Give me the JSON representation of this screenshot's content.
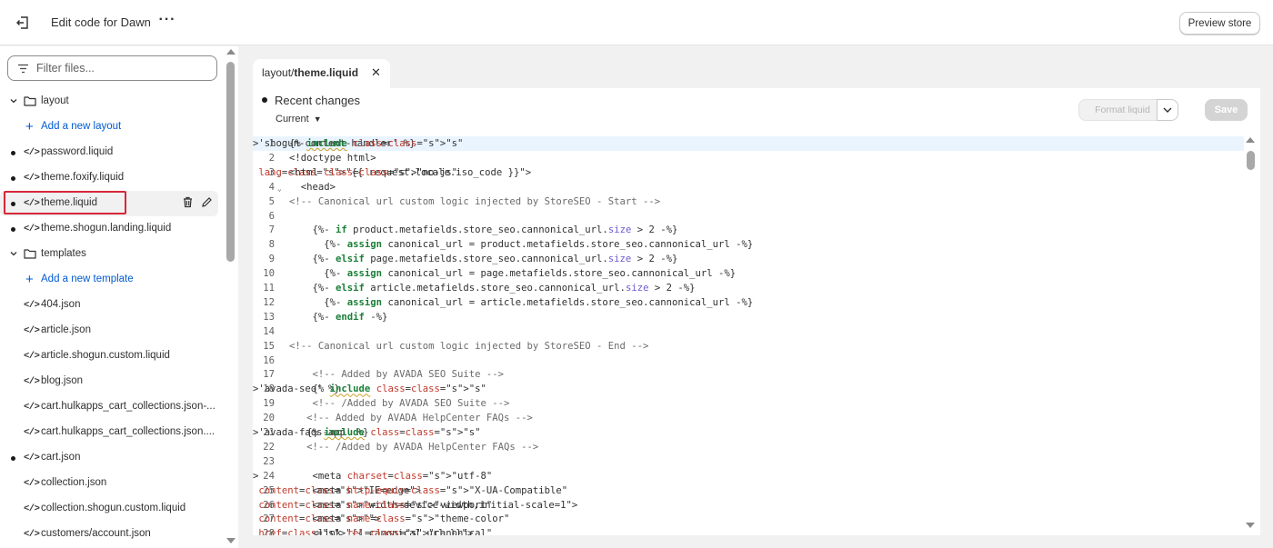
{
  "topbar": {
    "title": "Edit code for Dawn",
    "more_label": "···",
    "preview_label": "Preview store"
  },
  "sidebar": {
    "filter_placeholder": "Filter files...",
    "items": [
      {
        "type": "folder",
        "label": "layout"
      },
      {
        "type": "add",
        "label": "Add a new layout"
      },
      {
        "type": "file",
        "label": "password.liquid",
        "modified": true
      },
      {
        "type": "file",
        "label": "theme.foxify.liquid",
        "modified": true
      },
      {
        "type": "file",
        "label": "theme.liquid",
        "modified": true,
        "selected": true
      },
      {
        "type": "file",
        "label": "theme.shogun.landing.liquid",
        "modified": true
      },
      {
        "type": "folder",
        "label": "templates"
      },
      {
        "type": "add",
        "label": "Add a new template"
      },
      {
        "type": "file",
        "label": "404.json",
        "modified": false
      },
      {
        "type": "file",
        "label": "article.json",
        "modified": false
      },
      {
        "type": "file",
        "label": "article.shogun.custom.liquid",
        "modified": false
      },
      {
        "type": "file",
        "label": "blog.json",
        "modified": false
      },
      {
        "type": "file",
        "label": "cart.hulkapps_cart_collections.json-...",
        "modified": false
      },
      {
        "type": "file",
        "label": "cart.hulkapps_cart_collections.json....",
        "modified": false
      },
      {
        "type": "file",
        "label": "cart.json",
        "modified": true
      },
      {
        "type": "file",
        "label": "collection.json",
        "modified": false
      },
      {
        "type": "file",
        "label": "collection.shogun.custom.liquid",
        "modified": false
      },
      {
        "type": "file",
        "label": "customers/account.json",
        "modified": false
      }
    ]
  },
  "editor": {
    "tab": {
      "prefix": "layout/",
      "name": "theme.liquid"
    },
    "recent_changes": "Recent changes",
    "current_label": "Current",
    "format_label": "Format liquid",
    "save_label": "Save",
    "active_line": 1,
    "lines": [
      "{% include 'shogun-content-handler' %}",
      "<!doctype html>",
      "<html class=\"no-js\" lang=\"{{ request.locale.iso_code }}\">",
      "  <head>",
      "<!-- Canonical url custom logic injected by StoreSEO - Start -->",
      "",
      "    {%- if product.metafields.store_seo.cannonical_url.size > 2 -%}",
      "      {%- assign canonical_url = product.metafields.store_seo.cannonical_url -%}",
      "    {%- elsif page.metafields.store_seo.cannonical_url.size > 2 -%}",
      "      {%- assign canonical_url = page.metafields.store_seo.cannonical_url -%}",
      "    {%- elsif article.metafields.store_seo.cannonical_url.size > 2 -%}",
      "      {%- assign canonical_url = article.metafields.store_seo.cannonical_url -%}",
      "    {%- endif -%}",
      "",
      "<!-- Canonical url custom logic injected by StoreSEO - End -->",
      "",
      "    <!-- Added by AVADA SEO Suite -->",
      "    {% include 'avada-seo' %}",
      "    <!-- /Added by AVADA SEO Suite -->",
      "   <!-- Added by AVADA HelpCenter FAQs -->",
      "   {% include 'avada-faqs-app' %}",
      "   <!-- /Added by AVADA HelpCenter FAQs -->",
      "",
      "    <meta charset=\"utf-8\">",
      "    <meta http-equiv=\"X-UA-Compatible\" content=\"IE=edge\">",
      "    <meta name=\"viewport\" content=\"width=device-width,initial-scale=1\">",
      "    <meta name=\"theme-color\" content=\"\">",
      "    <link rel=\"canonical\" href=\"{{ canonical_url }}\">"
    ]
  }
}
